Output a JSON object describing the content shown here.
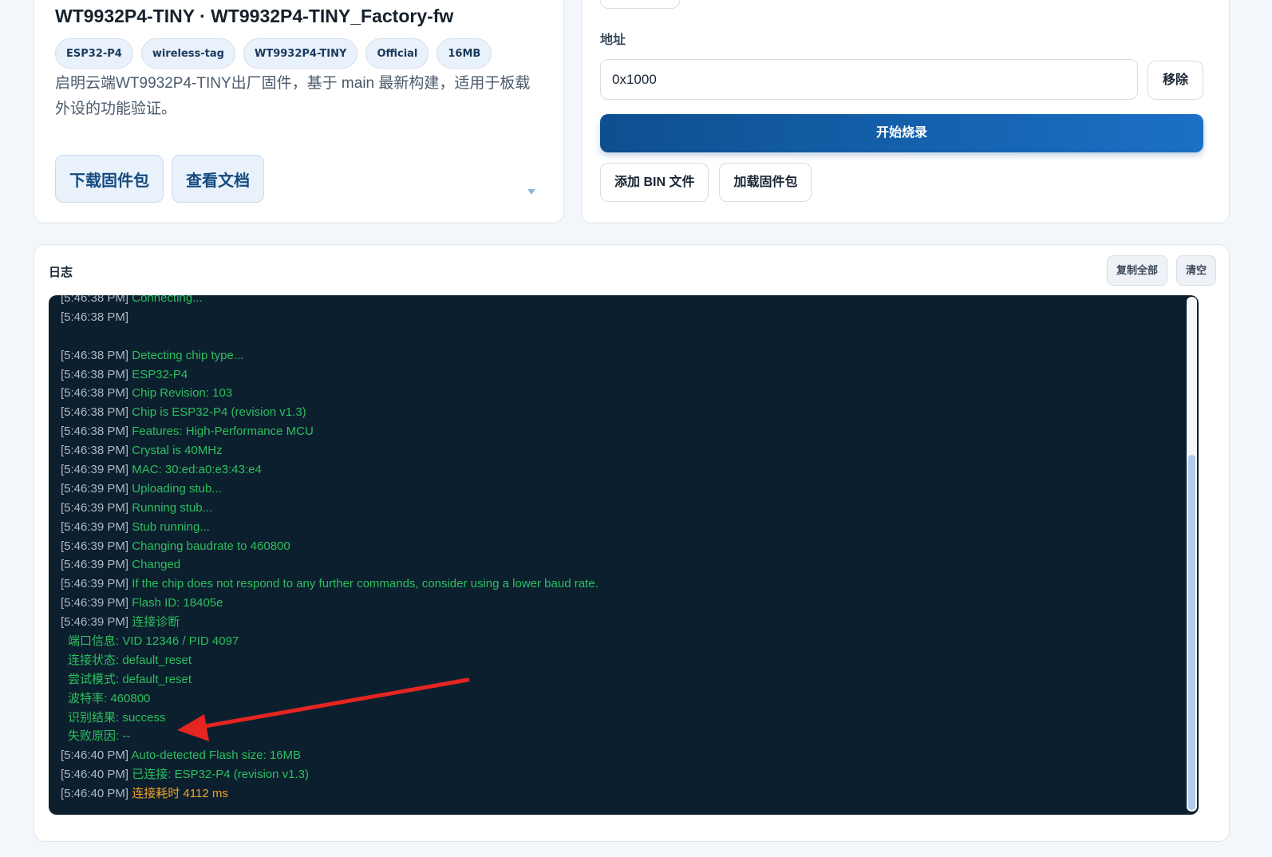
{
  "firmware": {
    "title": "WT9932P4-TINY · WT9932P4-TINY_Factory-fw",
    "tags": [
      "ESP32-P4",
      "wireless-tag",
      "WT9932P4-TINY",
      "Official",
      "16MB"
    ],
    "description": "启明云端WT9932P4-TINY出厂固件，基于 main 最新构建，适用于板载外设的功能验证。",
    "download_label": "下载固件包",
    "docs_label": "查看文档"
  },
  "flasher": {
    "address_label": "地址",
    "address_value": "0x1000",
    "remove_label": "移除",
    "start_label": "开始烧录",
    "add_bin_label": "添加 BIN 文件",
    "load_package_label": "加载固件包"
  },
  "log": {
    "title": "日志",
    "copy_all_label": "复制全部",
    "clear_label": "清空",
    "lines": [
      {
        "ts": "[5:46:38 PM]",
        "msg": "Connecting..."
      },
      {
        "ts": "[5:46:38 PM]",
        "msg": ""
      },
      {
        "ts": "",
        "msg": ""
      },
      {
        "ts": "[5:46:38 PM]",
        "msg": "Detecting chip type..."
      },
      {
        "ts": "[5:46:38 PM]",
        "msg": "ESP32-P4"
      },
      {
        "ts": "[5:46:38 PM]",
        "msg": "Chip Revision: 103"
      },
      {
        "ts": "[5:46:38 PM]",
        "msg": "Chip is ESP32-P4 (revision v1.3)"
      },
      {
        "ts": "[5:46:38 PM]",
        "msg": "Features: High-Performance MCU"
      },
      {
        "ts": "[5:46:38 PM]",
        "msg": "Crystal is 40MHz"
      },
      {
        "ts": "[5:46:39 PM]",
        "msg": "MAC: 30:ed:a0:e3:43:e4"
      },
      {
        "ts": "[5:46:39 PM]",
        "msg": "Uploading stub..."
      },
      {
        "ts": "[5:46:39 PM]",
        "msg": "Running stub..."
      },
      {
        "ts": "[5:46:39 PM]",
        "msg": "Stub running..."
      },
      {
        "ts": "[5:46:39 PM]",
        "msg": "Changing baudrate to 460800"
      },
      {
        "ts": "[5:46:39 PM]",
        "msg": "Changed"
      },
      {
        "ts": "[5:46:39 PM]",
        "msg": "If the chip does not respond to any further commands, consider using a lower baud rate."
      },
      {
        "ts": "[5:46:39 PM]",
        "msg": "Flash ID: 18405e"
      },
      {
        "ts": "[5:46:39 PM]",
        "msg": "连接诊断"
      },
      {
        "ts": "",
        "msg": "端口信息: VID 12346 / PID 4097",
        "indent": true
      },
      {
        "ts": "",
        "msg": "连接状态: default_reset",
        "indent": true
      },
      {
        "ts": "",
        "msg": "尝试模式: default_reset",
        "indent": true
      },
      {
        "ts": "",
        "msg": "波特率: 460800",
        "indent": true
      },
      {
        "ts": "",
        "msg": "识别结果: success",
        "indent": true
      },
      {
        "ts": "",
        "msg": "失败原因: --",
        "indent": true
      },
      {
        "ts": "[5:46:40 PM]",
        "msg": "Auto-detected Flash size: 16MB"
      },
      {
        "ts": "[5:46:40 PM]",
        "msg": "已连接: ESP32-P4 (revision v1.3)"
      },
      {
        "ts": "[5:46:40 PM]",
        "msg": "连接耗时 4112 ms",
        "warn": true
      }
    ]
  },
  "colors": {
    "terminal_bg": "#0c1f2e",
    "log_green": "#2dbf5f",
    "log_warn": "#f0a12c",
    "accent": "#1b70c6",
    "annotation_arrow": "#e52521"
  }
}
